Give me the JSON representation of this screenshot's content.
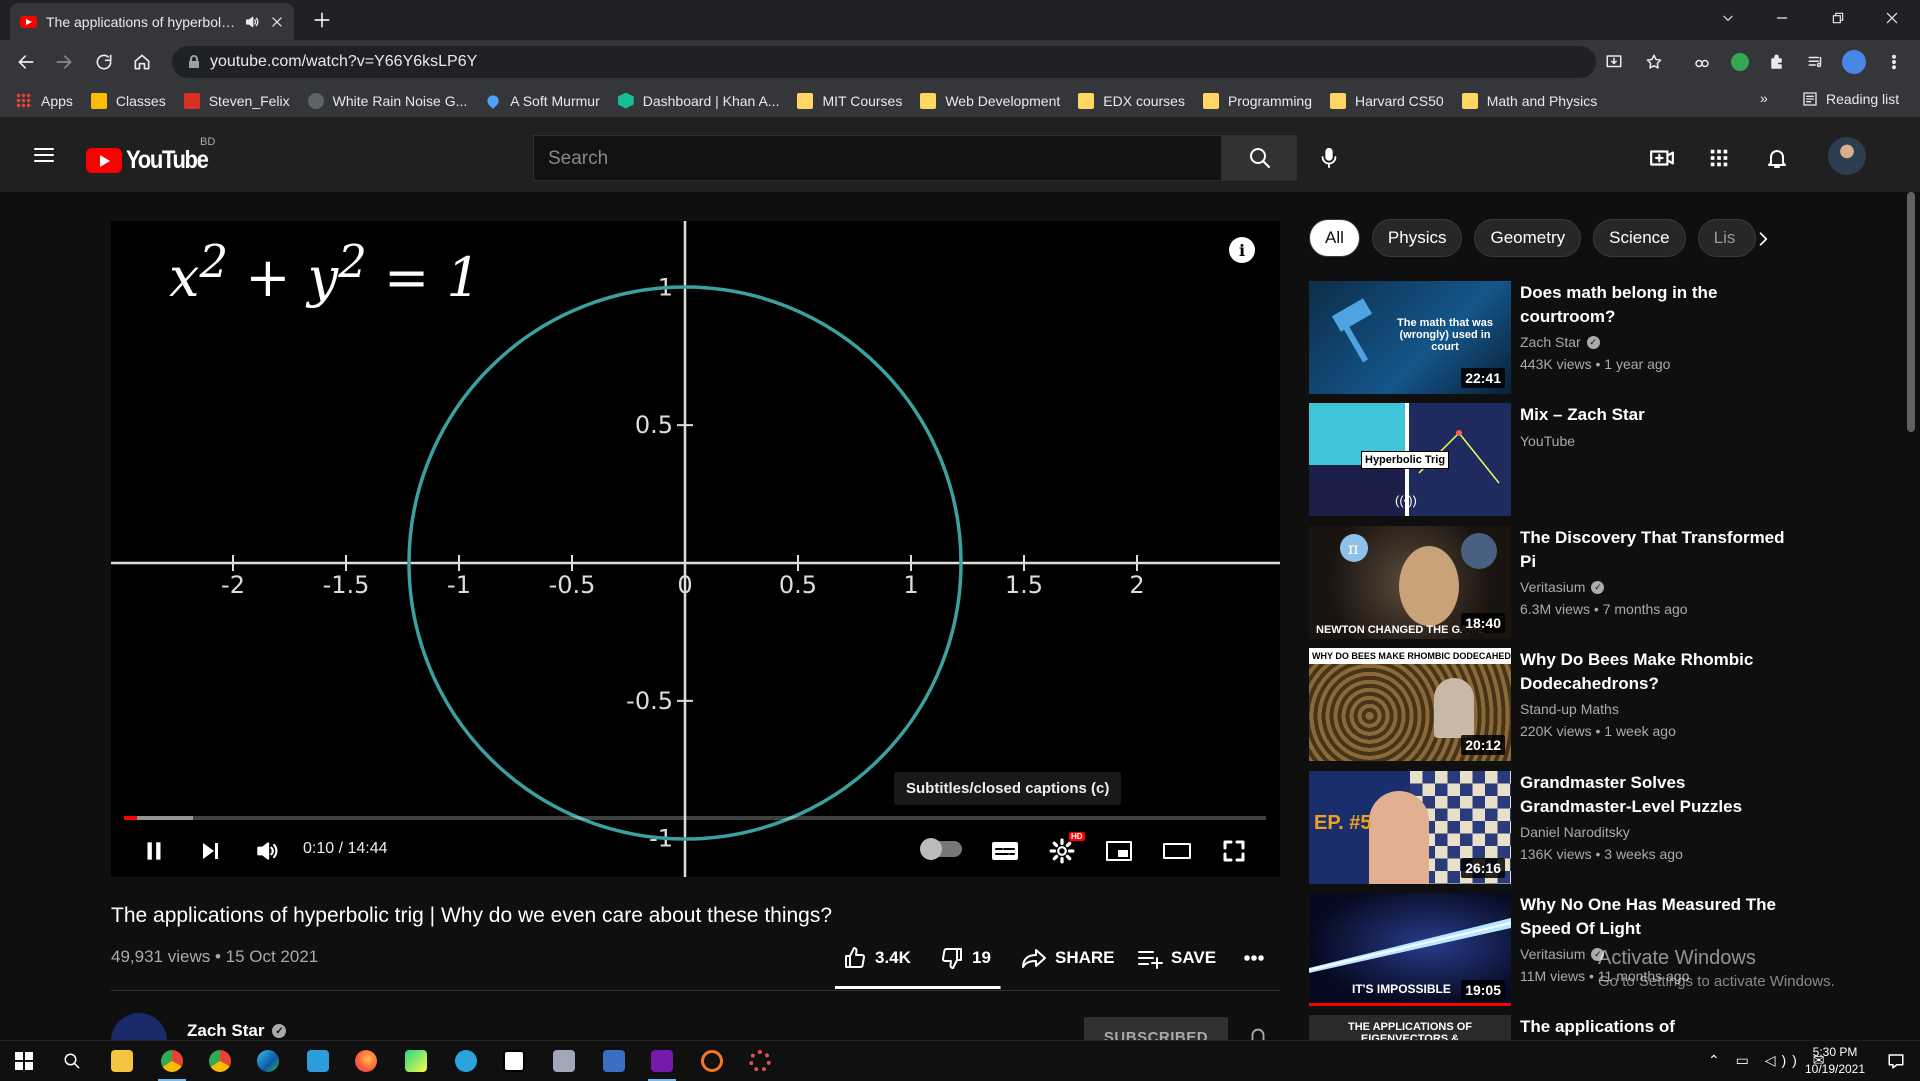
{
  "browser": {
    "tab_title": "The applications of hyperbolic trig | Why do we even care about these things? - YouTube",
    "url": "youtube.com/watch?v=Y66Y6ksLP6Y",
    "bookmarks": [
      {
        "label": "Apps",
        "icon": "apps-grid-icon",
        "color": "#ea4335"
      },
      {
        "label": "Classes",
        "icon": "classroom-icon",
        "color": "#fbbc04"
      },
      {
        "label": "Steven_Felix",
        "icon": "uva-icon",
        "color": "#d93025"
      },
      {
        "label": "White Rain Noise G...",
        "icon": "noise-icon",
        "color": "#5f6368"
      },
      {
        "label": "A Soft Murmur",
        "icon": "drop-icon",
        "color": "#4da3ff"
      },
      {
        "label": "Dashboard | Khan A...",
        "icon": "khan-icon",
        "color": "#14bf96"
      },
      {
        "label": "MIT Courses",
        "icon": "folder-icon",
        "color": "#fdd663"
      },
      {
        "label": "Web Development",
        "icon": "folder-icon",
        "color": "#fdd663"
      },
      {
        "label": "EDX courses",
        "icon": "folder-icon",
        "color": "#fdd663"
      },
      {
        "label": "Programming",
        "icon": "folder-icon",
        "color": "#fdd663"
      },
      {
        "label": "Harvard CS50",
        "icon": "folder-icon",
        "color": "#fdd663"
      },
      {
        "label": "Math and Physics",
        "icon": "folder-icon",
        "color": "#fdd663"
      }
    ],
    "more": "»",
    "reading_list": "Reading list"
  },
  "yt": {
    "logo": "YouTube",
    "country": "BD",
    "search_placeholder": "Search"
  },
  "video": {
    "equation_html": "x<sup>2</sup> + y<sup>2</sup> = 1",
    "x_ticks": [
      "-2",
      "-1.5",
      "-1",
      "-0.5",
      "0",
      "0.5",
      "1",
      "1.5",
      "2"
    ],
    "y_ticks": [
      "1",
      "0.5",
      "-0.5",
      "-1"
    ],
    "curve_color": "#3aa0a0",
    "tooltip": "Subtitles/closed captions (c)",
    "time": "0:10 / 14:44",
    "progress_played": 0.0115,
    "progress_loaded": 0.06,
    "hd_badge": "HD"
  },
  "info": {
    "title": "The applications of hyperbolic trig | Why do we even care about these things?",
    "meta": "49,931 views • 15 Oct 2021",
    "likes": "3.4K",
    "dislikes": "19",
    "like_ratio": 0.994,
    "share": "SHARE",
    "save": "SAVE",
    "channel": "Zach Star",
    "subscribe": "SUBSCRIBED"
  },
  "chips": [
    "All",
    "Physics",
    "Geometry",
    "Science",
    "Lis"
  ],
  "recs": [
    {
      "title": "Does math belong in the courtroom?",
      "channel": "Zach Star",
      "verified": true,
      "meta": "443K views • 1 year ago",
      "duration": "22:41",
      "thumb_text": "The math that was (wrongly) used in court"
    },
    {
      "title": "Mix – Zach Star",
      "channel": "YouTube",
      "verified": false,
      "meta": "",
      "duration": "",
      "thumb_text": "Hyperbolic Trig"
    },
    {
      "title": "The Discovery That Transformed Pi",
      "channel": "Veritasium",
      "verified": true,
      "meta": "6.3M views • 7 months ago",
      "duration": "18:40",
      "thumb_text": "NEWTON CHANGED THE GAME"
    },
    {
      "title": "Why Do Bees Make Rhombic Dodecahedrons?",
      "channel": "Stand-up Maths",
      "verified": false,
      "meta": "220K views • 1 week ago",
      "duration": "20:12",
      "thumb_text": "WHY DO BEES MAKE RHOMBIC DODECAHEDRONS?"
    },
    {
      "title": "Grandmaster Solves Grandmaster-Level Puzzles",
      "channel": "Daniel Naroditsky",
      "verified": false,
      "meta": "136K views • 3 weeks ago",
      "duration": "26:16",
      "thumb_text": "EP. #5"
    },
    {
      "title": "Why No One Has Measured The Speed Of Light",
      "channel": "Veritasium",
      "verified": true,
      "meta": "11M views • 11 months ago",
      "duration": "19:05",
      "thumb_text": "IT'S IMPOSSIBLE"
    },
    {
      "title": "The applications of",
      "channel": "",
      "verified": false,
      "meta": "",
      "duration": "",
      "thumb_text": "THE APPLICATIONS OF EIGENVECTORS & EIGENVALUES"
    }
  ],
  "activation": {
    "line1": "Activate Windows",
    "line2": "Go to Settings to activate Windows."
  },
  "taskbar": {
    "time": "5:30 PM",
    "date": "10/19/2021"
  }
}
